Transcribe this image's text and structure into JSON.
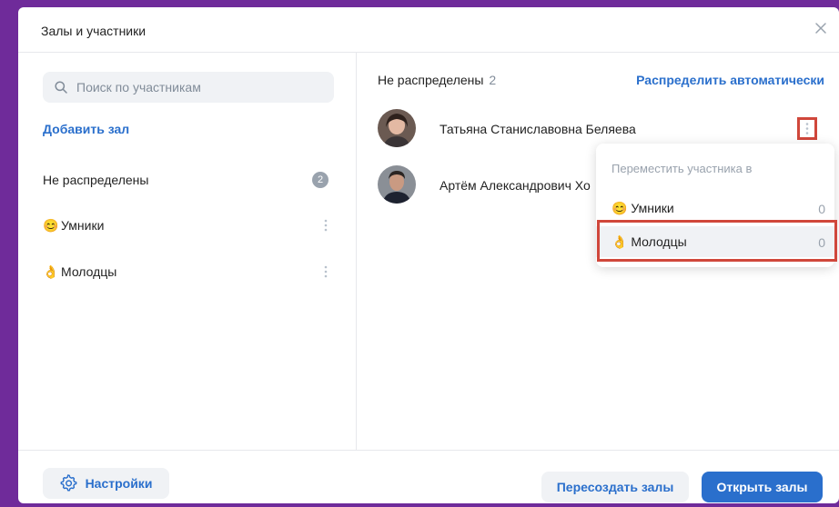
{
  "dialog": {
    "title": "Залы и участники"
  },
  "sidebar": {
    "search_placeholder": "Поиск по участникам",
    "add_hall_label": "Добавить зал",
    "halls": [
      {
        "label": "Не распределены",
        "badge": "2",
        "icon": ""
      },
      {
        "label": "Умники",
        "icon": "😊"
      },
      {
        "label": "Молодцы",
        "icon": "👌"
      }
    ]
  },
  "main": {
    "unassigned_label": "Не распределены",
    "unassigned_count": "2",
    "auto_distribute_label": "Распределить автоматически",
    "participants": [
      {
        "name": "Татьяна Станиславовна Беляева",
        "avatar": "avatar-photo-woman"
      },
      {
        "name": "Артём Александрович Хо",
        "avatar": "avatar-photo-man"
      }
    ]
  },
  "move_menu": {
    "title": "Переместить участника в",
    "items": [
      {
        "icon": "😊",
        "label": "Умники",
        "count": "0"
      },
      {
        "icon": "👌",
        "label": "Молодцы",
        "count": "0"
      }
    ]
  },
  "footer": {
    "settings_label": "Настройки",
    "recreate_label": "Пересоздать залы",
    "open_label": "Открыть залы"
  },
  "colors": {
    "accent": "#2a6fcc",
    "frame": "#6f2b9a",
    "highlight_outline": "#d0473b"
  }
}
